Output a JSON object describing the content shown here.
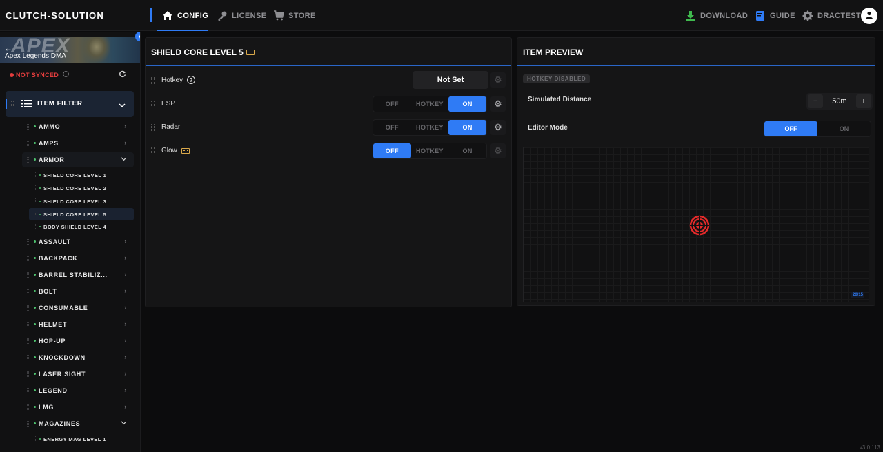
{
  "header": {
    "brand": "CLUTCH-SOLUTION",
    "nav": [
      {
        "label": "CONFIG",
        "icon": "home-icon",
        "active": true
      },
      {
        "label": "LICENSE",
        "icon": "key-icon",
        "active": false
      },
      {
        "label": "STORE",
        "icon": "cart-icon",
        "active": false
      }
    ],
    "right": [
      {
        "label": "DOWNLOAD",
        "icon": "download-icon"
      },
      {
        "label": "GUIDE",
        "icon": "book-icon"
      },
      {
        "label": "DRACTEST",
        "icon": "gear-icon"
      }
    ]
  },
  "sidebar": {
    "game_title": "Apex Legends DMA",
    "banner_logo": "APEX",
    "sync_status": "NOT SYNCED",
    "filter_label": "ITEM FILTER",
    "categories": [
      {
        "label": "AMMO",
        "open": false
      },
      {
        "label": "AMPS",
        "open": false
      },
      {
        "label": "ARMOR",
        "open": true
      },
      {
        "label": "ASSAULT",
        "open": false
      },
      {
        "label": "BACKPACK",
        "open": false
      },
      {
        "label": "BARREL STABILIZ...",
        "open": false
      },
      {
        "label": "BOLT",
        "open": false
      },
      {
        "label": "CONSUMABLE",
        "open": false
      },
      {
        "label": "HELMET",
        "open": false
      },
      {
        "label": "HOP-UP",
        "open": false
      },
      {
        "label": "KNOCKDOWN",
        "open": false
      },
      {
        "label": "LASER SIGHT",
        "open": false
      },
      {
        "label": "LEGEND",
        "open": false
      },
      {
        "label": "LMG",
        "open": false
      },
      {
        "label": "MAGAZINES",
        "open": true
      }
    ],
    "armor_items": [
      "SHIELD CORE LEVEL 1",
      "SHIELD CORE LEVEL 2",
      "SHIELD CORE LEVEL 3",
      "SHIELD CORE LEVEL 5",
      "BODY SHIELD LEVEL 4"
    ],
    "magazine_items": [
      "ENERGY MAG LEVEL 1"
    ]
  },
  "config": {
    "title": "SHIELD CORE LEVEL 5",
    "hotkey_label": "Hotkey",
    "hotkey_value": "Not Set",
    "rows": [
      {
        "label": "ESP",
        "state": "ON"
      },
      {
        "label": "Radar",
        "state": "ON"
      },
      {
        "label": "Glow",
        "state": "OFF"
      }
    ],
    "seg_labels": {
      "off": "OFF",
      "hotkey": "HOTKEY",
      "on": "ON"
    }
  },
  "preview": {
    "title": "ITEM PREVIEW",
    "badge": "HOTKEY DISABLED",
    "distance_label": "Simulated Distance",
    "distance_value": "50m",
    "editor_label": "Editor Mode",
    "editor_off": "OFF",
    "editor_on": "ON",
    "editor_state": "OFF",
    "marker_color": "#e52a2a",
    "distance_badge": "20/15"
  },
  "version": "v3.0.113"
}
